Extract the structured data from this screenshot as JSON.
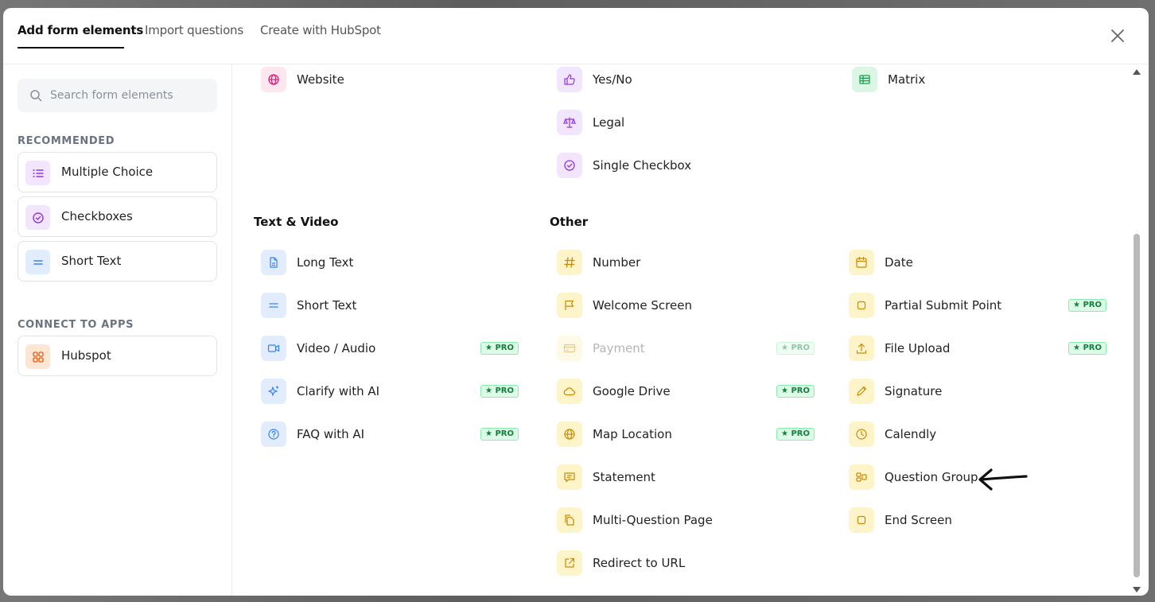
{
  "tabs": [
    {
      "label": "Add form elements",
      "active": true
    },
    {
      "label": "Import questions",
      "active": false
    },
    {
      "label": "Create with HubSpot",
      "active": false
    }
  ],
  "search": {
    "placeholder": "Search form elements"
  },
  "sidebar": {
    "recommended_label": "RECOMMENDED",
    "recommended": [
      {
        "label": "Multiple Choice",
        "icon": "list-icon"
      },
      {
        "label": "Checkboxes",
        "icon": "check-circle-icon"
      },
      {
        "label": "Short Text",
        "icon": "short-text-icon"
      }
    ],
    "apps_label": "CONNECT TO APPS",
    "apps": [
      {
        "label": "Hubspot",
        "icon": "grid-icon"
      }
    ]
  },
  "content": {
    "top_col1": [
      {
        "label": "Website",
        "icon": "globe-icon"
      }
    ],
    "top_col2": [
      {
        "label": "Yes/No",
        "icon": "thumbs-up-icon"
      },
      {
        "label": "Legal",
        "icon": "scale-icon"
      },
      {
        "label": "Single Checkbox",
        "icon": "check-circle-icon"
      }
    ],
    "top_col3": [
      {
        "label": "Matrix",
        "icon": "table-icon"
      }
    ],
    "text_video": {
      "title": "Text & Video",
      "items": [
        {
          "label": "Long Text",
          "icon": "document-icon",
          "pro": false
        },
        {
          "label": "Short Text",
          "icon": "short-text-icon",
          "pro": false
        },
        {
          "label": "Video / Audio",
          "icon": "video-icon",
          "pro": true
        },
        {
          "label": "Clarify with AI",
          "icon": "sparkle-icon",
          "pro": true
        },
        {
          "label": "FAQ with AI",
          "icon": "question-icon",
          "pro": true
        }
      ]
    },
    "other": {
      "title": "Other",
      "col1": [
        {
          "label": "Number",
          "icon": "hash-icon",
          "pro": false
        },
        {
          "label": "Welcome Screen",
          "icon": "flag-icon",
          "pro": false
        },
        {
          "label": "Payment",
          "icon": "card-icon",
          "pro": true,
          "disabled": true
        },
        {
          "label": "Google Drive",
          "icon": "cloud-icon",
          "pro": true
        },
        {
          "label": "Map Location",
          "icon": "globe-icon",
          "pro": true
        },
        {
          "label": "Statement",
          "icon": "message-icon",
          "pro": false
        },
        {
          "label": "Multi-Question Page",
          "icon": "pages-icon",
          "pro": false
        },
        {
          "label": "Redirect to URL",
          "icon": "external-link-icon",
          "pro": false
        }
      ],
      "col2": [
        {
          "label": "Date",
          "icon": "calendar-icon",
          "pro": false
        },
        {
          "label": "Partial Submit Point",
          "icon": "square-icon",
          "pro": true
        },
        {
          "label": "File Upload",
          "icon": "upload-icon",
          "pro": true
        },
        {
          "label": "Signature",
          "icon": "pen-icon",
          "pro": false
        },
        {
          "label": "Calendly",
          "icon": "clock-icon",
          "pro": false
        },
        {
          "label": "Question Group",
          "icon": "group-icon",
          "pro": false
        },
        {
          "label": "End Screen",
          "icon": "square-icon",
          "pro": false
        }
      ]
    },
    "pro_label": "★ PRO"
  },
  "colors": {
    "pink": "#e11d74",
    "purple": "#9333ea",
    "green": "#16a34a",
    "blue": "#3b82f6",
    "yellow": "#ca8a04",
    "orange": "#ea580c"
  }
}
